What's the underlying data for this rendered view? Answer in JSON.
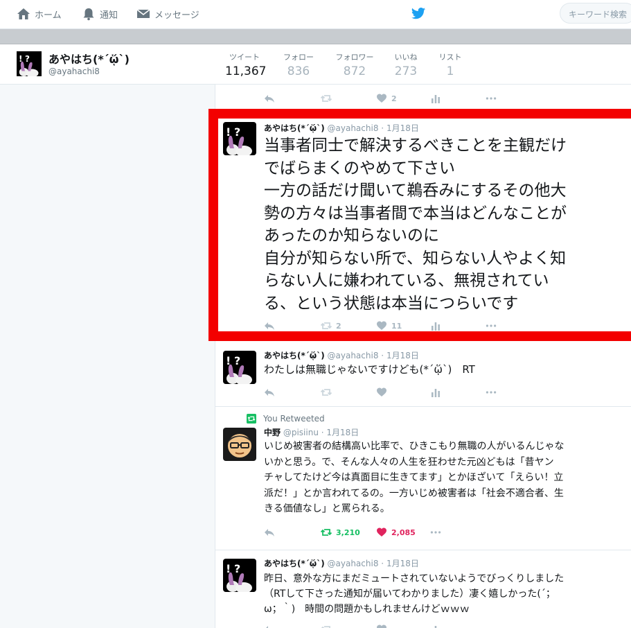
{
  "nav": {
    "home": "ホーム",
    "notifications": "通知",
    "messages": "メッセージ",
    "search_placeholder": "キーワード検索"
  },
  "profile": {
    "name": "あやはち(*´ᾥ`)",
    "handle": "@ayahachi8",
    "stats": [
      {
        "label": "ツイート",
        "value": "11,367"
      },
      {
        "label": "フォロー",
        "value": "836"
      },
      {
        "label": "フォロワー",
        "value": "872"
      },
      {
        "label": "いいね",
        "value": "273"
      },
      {
        "label": "リスト",
        "value": "1"
      }
    ]
  },
  "top_actions": {
    "likes": "2"
  },
  "tweets": [
    {
      "name": "あやはち(*´ᾥ`)",
      "handle": "@ayahachi8",
      "date": "1月18日",
      "lines": [
        "当事者同士で解決するべきことを主観だけ",
        "でばらまくのやめて下さい",
        "一方の話だけ聞いて鵜呑みにするその他大",
        "勢の方々は当事者間で本当はどんなことが",
        "あったのか知らないのに",
        "自分が知らない所で、知らない人やよく知",
        "らない人に嫌われている、無視されてい",
        "る、という状態は本当につらいです"
      ],
      "retweets": "2",
      "likes": "11"
    },
    {
      "name": "あやはち(*´ᾥ`)",
      "handle": "@ayahachi8",
      "date": "1月18日",
      "lines": [
        "わたしは無職じゃないですけども(*´ᾥ`)　RT"
      ],
      "retweets": "",
      "likes": ""
    },
    {
      "retweeted_label": "You Retweeted",
      "name": "中野",
      "handle": "@pisiinu",
      "date": "1月18日",
      "lines": [
        "いじめ被害者の結構高い比率で、ひきこもり無職の人がいるんじゃな",
        "いかと思う。で、そんな人々の人生を狂わせた元凶どもは「昔ヤン",
        "チャしてたけど今は真面目に生きてます」とかほざいて「えらい！立",
        "派だ！」とか言われてるの。一方いじめ被害者は「社会不適合者、生",
        "きる価値なし」と罵られる。"
      ],
      "retweets": "3,210",
      "likes": "2,085"
    },
    {
      "name": "あやはち(*´ᾥ`)",
      "handle": "@ayahachi8",
      "date": "1月18日",
      "lines": [
        "昨日、意外な方にまだミュートされていないようでびっくりしました",
        "（RTして下さった通知が届いてわかりました）凄く嬉しかった(´；",
        "ω；｀)　時間の問題かもしれませんけどｗｗｗ"
      ],
      "retweets": "",
      "likes": ""
    }
  ],
  "colors": {
    "accent": "#1da1f2",
    "highlight_box": "#f30000",
    "retweet_green": "#17bf63",
    "like_red": "#e0245e"
  }
}
